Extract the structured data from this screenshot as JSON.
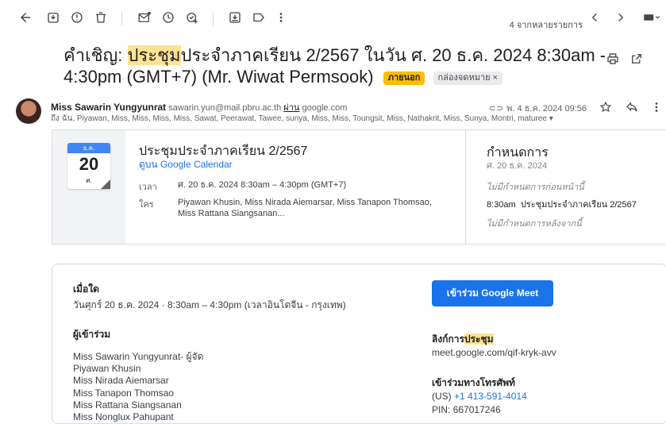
{
  "toolbar": {
    "pager": "4 จากหลายรายการ"
  },
  "subject": {
    "prefix": "คำเชิญ: ",
    "highlight": "ประชุม",
    "rest": "ประจำภาคเรียน 2/2567 ในวัน ศ. 20 ธ.ค. 2024 8:30am - 4:30pm (GMT+7) (Mr. Wiwat Permsook)",
    "tag_external": "ภายนอก",
    "tag_inbox": "กล่องจดหมาย ×"
  },
  "sender": {
    "name": "Miss Sawarin Yungyunrat",
    "email": "sawarin.yun@mail.pbru.ac.th",
    "via_label": "ผ่าน",
    "via": "google.com",
    "to": "ถึง ฉัน, Piyawan, Miss, Miss, Miss, Miss, Sawat, Peerawat, Tawee, sunya, Miss, Miss, Toungsit, Miss, Nathakrit, Miss, Sunya, Montri, maturee ▾",
    "date": "พ. 4 ธ.ค. 2024 09:56"
  },
  "event_card": {
    "month": "ธ.ค.",
    "day": "20",
    "dow": "ศ.",
    "title": "ประชุมประจำภาคเรียน 2/2567",
    "view_link": "ดูบน Google Calendar",
    "time_label": "เวลา",
    "time_value": "ศ. 20 ธ.ค. 2024 8:30am – 4:30pm (GMT+7)",
    "who_label": "ใคร",
    "who_value": "Piyawan Khusin, Miss Nirada Aiemarsar, Miss Tanapon Thomsao, Miss Rattana Siangsanan..."
  },
  "schedule": {
    "title": "กำหนดการ",
    "date": "ศ. 20 ธ.ค. 2024",
    "none_before": "ไม่มีกำหนดการก่อนหน้านี้",
    "event_time": "8:30am",
    "event_name": "ประชุมประจำภาคเรียน 2/2567",
    "none_after": "ไม่มีกำหนดการหลังจากนี้"
  },
  "details": {
    "when_label": "เมื่อใด",
    "when_value": "วันศุกร์ 20 ธ.ค. 2024 · 8:30am – 4:30pm (เวลาอินโดจีน - กรุงเทพ)",
    "join_button": "เข้าร่วม Google Meet",
    "attendees_label": "ผู้เข้าร่วม",
    "attendees": [
      "Miss Sawarin Yungyunrat- ผู้จัด",
      "Piyawan Khusin",
      "Miss Nirada Aiemarsar",
      "Miss Tanapon Thomsao",
      "Miss Rattana Siangsanan",
      "Miss Nonglux Pahupant"
    ],
    "meeting_link_label_prefix": "ลิงก์การ",
    "meeting_link_label_hl": "ประชุม",
    "meeting_link": "meet.google.com/qif-kryk-avv",
    "phone_label": "เข้าร่วมทางโทรศัพท์",
    "phone_country": "(US) ",
    "phone_number": "+1 413-591-4014",
    "pin": "PIN: 667017246"
  }
}
